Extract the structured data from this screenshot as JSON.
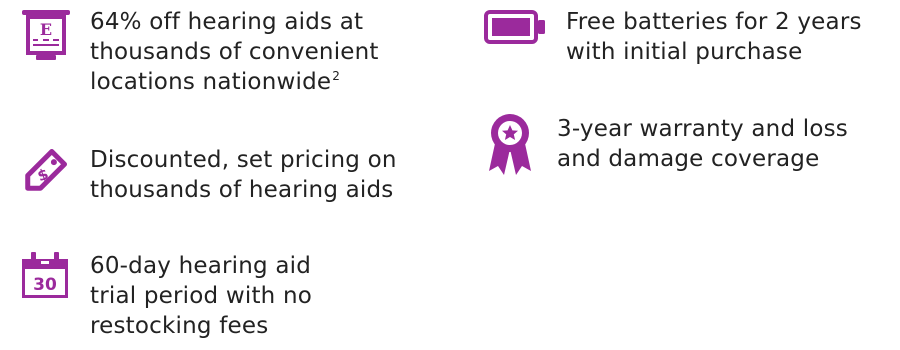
{
  "theme": {
    "accent": "#9B2A9C",
    "text": "#222222",
    "background": "#FFFFFF"
  },
  "benefits": [
    {
      "icon": "eye-chart-icon",
      "icon_glyph": "E",
      "lines": [
        "64% off hearing aids at",
        "thousands of convenient",
        "locations nationwide"
      ],
      "footnote": "2"
    },
    {
      "icon": "price-tag-icon",
      "lines": [
        "Discounted, set pricing on",
        "thousands of hearing aids"
      ]
    },
    {
      "icon": "calendar-icon",
      "icon_glyph": "30",
      "lines": [
        "60-day hearing aid",
        "trial period with no",
        "restocking fees"
      ]
    },
    {
      "icon": "battery-icon",
      "lines": [
        "Free batteries for 2 years",
        "with initial purchase"
      ]
    },
    {
      "icon": "award-ribbon-icon",
      "lines": [
        "3-year warranty and loss",
        "and damage coverage"
      ]
    }
  ]
}
